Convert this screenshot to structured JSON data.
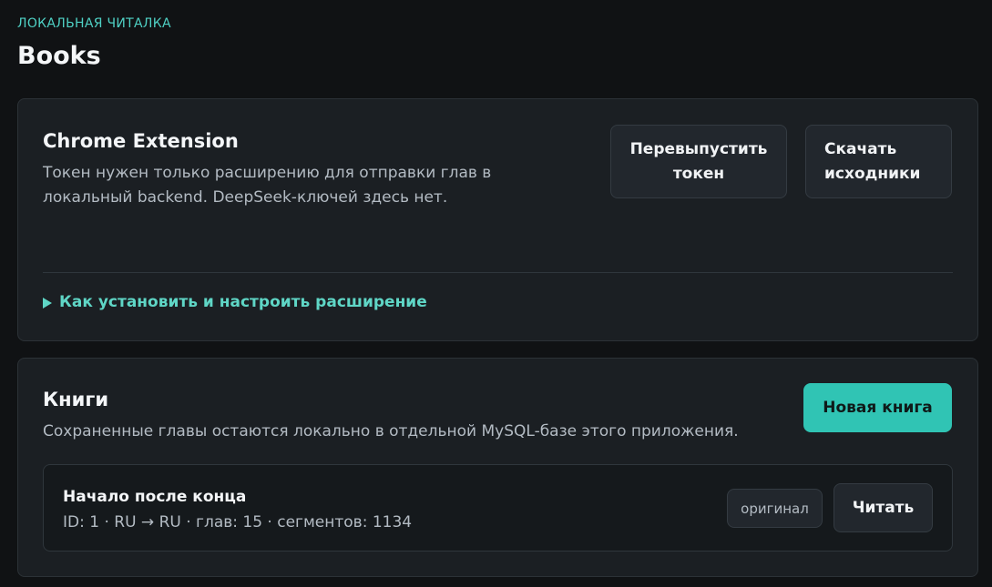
{
  "header": {
    "eyebrow": "ЛОКАЛЬНАЯ ЧИТАЛКА",
    "title": "Books"
  },
  "extension": {
    "title": "Chrome Extension",
    "description_line1": "Токен нужен только расширению для отправки глав в",
    "description_line2": "локальный backend. DeepSeek-ключей здесь нет.",
    "reissue_line1": "Перевыпустить",
    "reissue_line2": "токен",
    "download_line1": "Скачать",
    "download_line2": "исходники",
    "setup_label": "Как установить и настроить расширение",
    "colors": {
      "accent": "#5fd6c6"
    }
  },
  "books": {
    "title": "Книги",
    "description": "Сохраненные главы остаются локально в отдельной MySQL-базе этого приложения.",
    "new_book_label": "Новая книга",
    "items": [
      {
        "title": "Начало после конца",
        "meta": "ID: 1 · RU → RU · глав: 15 · сегментов: 1134",
        "badge": "оригинал",
        "read_label": "Читать"
      }
    ]
  },
  "colors": {
    "background": "#101214",
    "card": "#1b1f23",
    "primary_button": "#30c4b4"
  }
}
